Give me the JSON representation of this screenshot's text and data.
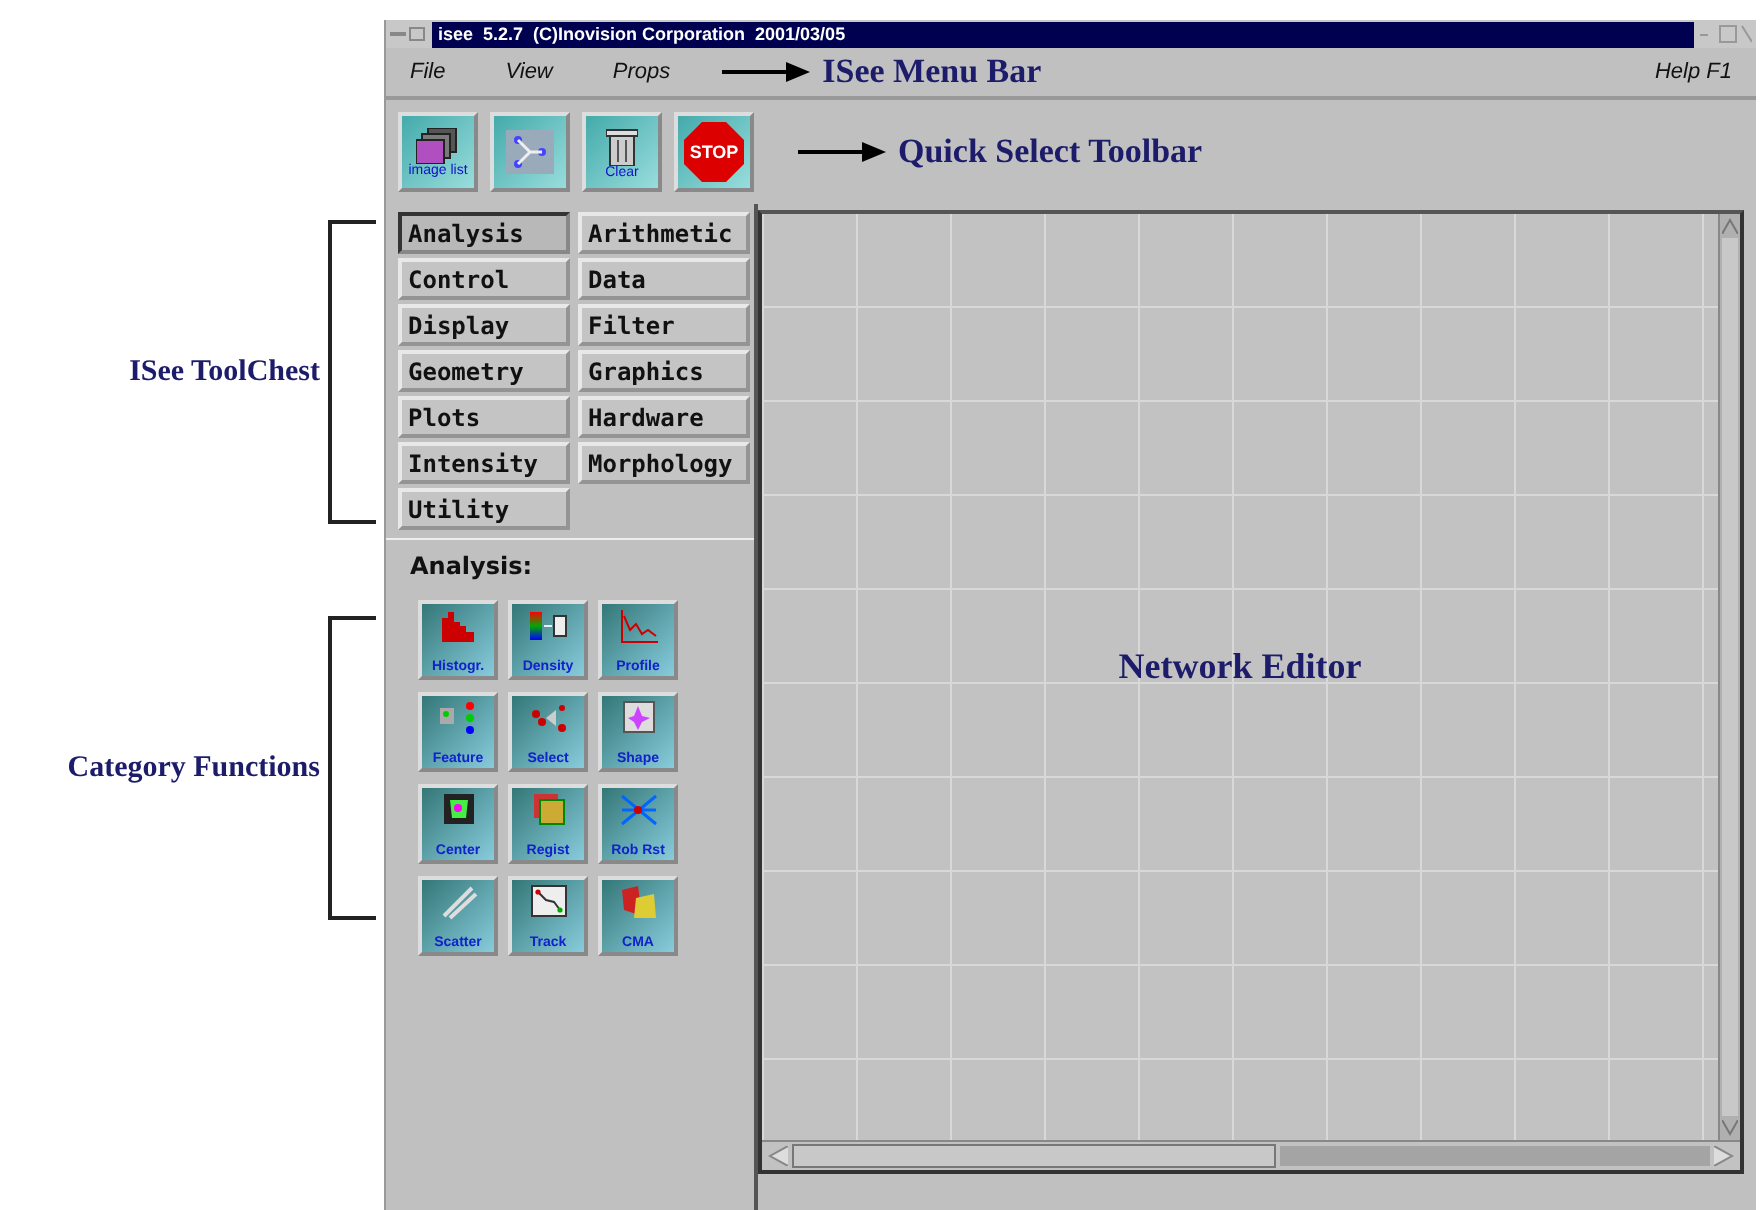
{
  "window": {
    "title": "isee  5.2.7  (C)Inovision Corporation  2001/03/05"
  },
  "menu_bar": {
    "items": [
      "File",
      "View",
      "Props"
    ],
    "help": "Help F1"
  },
  "toolbar": {
    "buttons": [
      {
        "kind": "image-list",
        "label": "image list"
      },
      {
        "kind": "network"
      },
      {
        "kind": "clear",
        "label": "Clear"
      },
      {
        "kind": "stop",
        "label": "STOP"
      }
    ]
  },
  "toolchest": {
    "categories": [
      {
        "label": "Analysis",
        "selected": true
      },
      {
        "label": "Arithmetic",
        "selected": false
      },
      {
        "label": "Control",
        "selected": false
      },
      {
        "label": "Data",
        "selected": false
      },
      {
        "label": "Display",
        "selected": false
      },
      {
        "label": "Filter",
        "selected": false
      },
      {
        "label": "Geometry",
        "selected": false
      },
      {
        "label": "Graphics",
        "selected": false
      },
      {
        "label": "Plots",
        "selected": false
      },
      {
        "label": "Hardware",
        "selected": false
      },
      {
        "label": "Intensity",
        "selected": false
      },
      {
        "label": "Morphology",
        "selected": false
      },
      {
        "label": "Utility",
        "selected": false
      }
    ]
  },
  "category_panel": {
    "title": "Analysis:",
    "functions": [
      {
        "kind": "histogram",
        "label": "Histogr."
      },
      {
        "kind": "density",
        "label": "Density"
      },
      {
        "kind": "profile",
        "label": "Profile"
      },
      {
        "kind": "feature",
        "label": "Feature"
      },
      {
        "kind": "select",
        "label": "Select"
      },
      {
        "kind": "shape",
        "label": "Shape"
      },
      {
        "kind": "center",
        "label": "Center"
      },
      {
        "kind": "regist",
        "label": "Regist"
      },
      {
        "kind": "rob",
        "label": "Rob Rst"
      },
      {
        "kind": "scatter",
        "label": "Scatter"
      },
      {
        "kind": "track",
        "label": "Track"
      },
      {
        "kind": "cma",
        "label": "CMA"
      }
    ]
  },
  "network_editor": {
    "label": "Network Editor"
  },
  "annotations": {
    "menu_bar": "ISee Menu Bar",
    "toolbar": "Quick Select Toolbar",
    "toolchest": "ISee ToolChest",
    "category_functions": "Category Functions"
  }
}
